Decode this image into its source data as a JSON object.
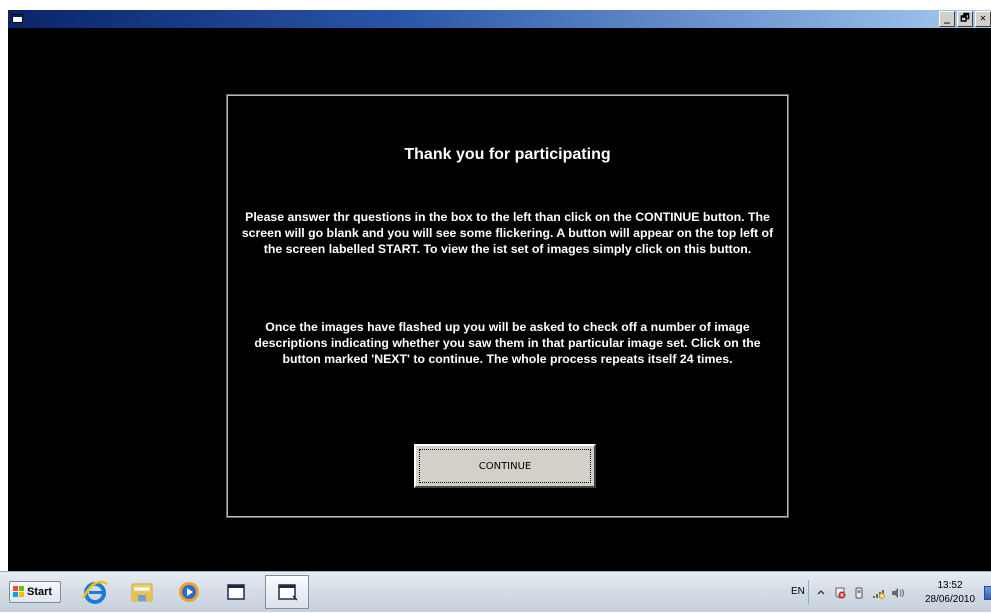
{
  "window": {
    "caption_buttons": [
      "_",
      "🗗",
      "✕"
    ]
  },
  "dialog": {
    "title": "Thank you for participating",
    "paragraph1": "Please answer thr questions in the box to the left than click on the CONTINUE button. The screen will go blank and you will see some flickering.  A button will appear on the top left of the screen labelled START.  To view the ist set of images simply click on this button.",
    "paragraph2": "Once the images have flashed up you will be asked to check off a number of image descriptions indicating whether you saw them in that particular image set.  Click on the button marked 'NEXT' to continue.  The whole process repeats itself 24 times.",
    "continue_label": "CONTINUE"
  },
  "taskbar": {
    "start_label": "Start",
    "pinned": [
      "internet-explorer-icon",
      "windows-explorer-icon",
      "media-player-icon",
      "app-window-icon",
      "app-window-active-icon"
    ],
    "language": "EN",
    "tray_icons": [
      "show-hidden-icons-chevron",
      "action-center-icon",
      "device-icon",
      "network-icon",
      "volume-icon"
    ],
    "clock_time": "13:52",
    "clock_date": "28/06/2010"
  }
}
